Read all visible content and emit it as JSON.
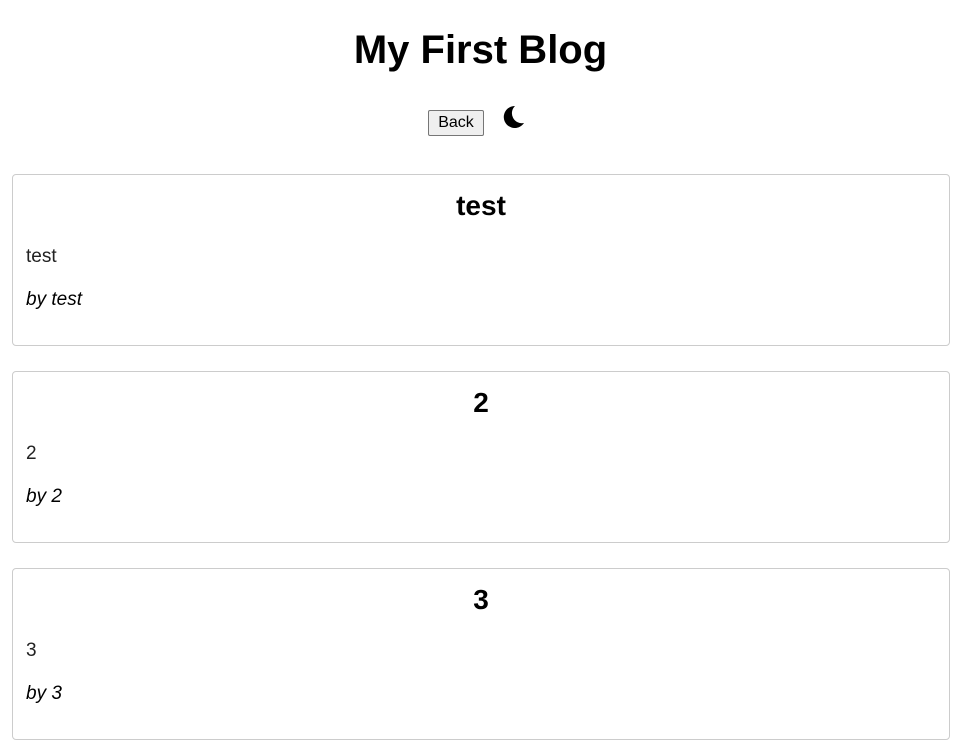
{
  "header": {
    "title": "My First Blog",
    "back_label": "Back",
    "theme_icon": "moon-icon"
  },
  "posts": [
    {
      "title": "test",
      "body": "test",
      "author": "by test"
    },
    {
      "title": "2",
      "body": "2",
      "author": "by 2"
    },
    {
      "title": "3",
      "body": "3",
      "author": "by 3"
    }
  ]
}
